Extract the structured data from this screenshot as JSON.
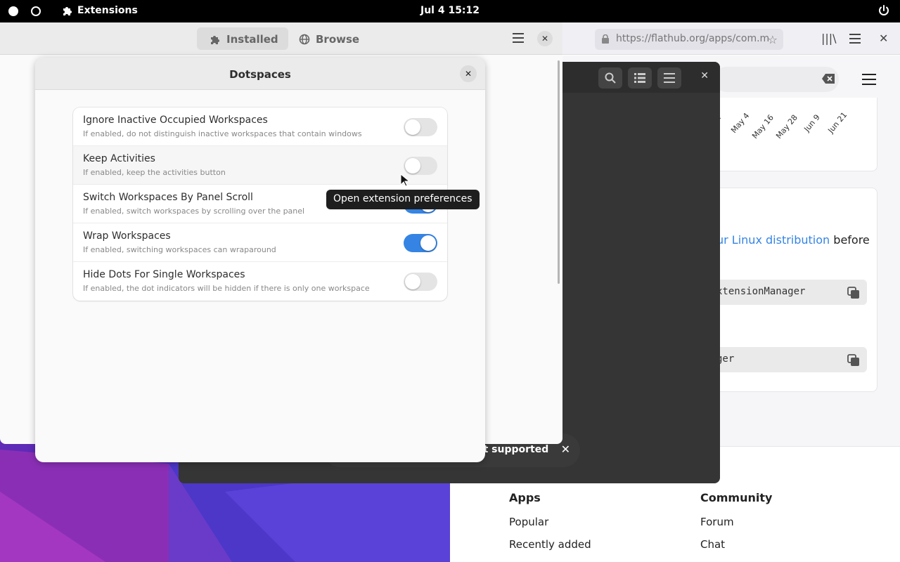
{
  "topbar": {
    "app_name": "Extensions",
    "clock": "Jul 4  15:12"
  },
  "browser": {
    "url": "https://flathub.org/apps/com.m",
    "chart_ticks": [
      "22",
      "May 4",
      "May 16",
      "May 28",
      "Jun 9",
      "Jun 21"
    ],
    "install_text_link": "ur Linux distribution",
    "install_text_rest": "before",
    "code_line_1": "xtensionManager",
    "code_line_2": "ger",
    "footer": {
      "apps_heading": "Apps",
      "apps_links": [
        "Popular",
        "Recently added"
      ],
      "community_heading": "Community",
      "community_links": [
        "Forum",
        "Chat"
      ]
    }
  },
  "dark_window": {
    "toast_text": "ot supported"
  },
  "extensions_window": {
    "tabs": [
      {
        "label": "Installed",
        "active": true
      },
      {
        "label": "Browse",
        "active": false
      }
    ]
  },
  "dialog": {
    "title": "Dotspaces",
    "rows": [
      {
        "title": "Ignore Inactive Occupied Workspaces",
        "subtitle": "If enabled, do not distinguish inactive workspaces that contain windows",
        "enabled": false
      },
      {
        "title": "Keep Activities",
        "subtitle": "If enabled, keep the activities button",
        "enabled": false
      },
      {
        "title": "Switch Workspaces By Panel Scroll",
        "subtitle": "If enabled, switch workspaces by scrolling over the panel",
        "enabled": true
      },
      {
        "title": "Wrap Workspaces",
        "subtitle": "If enabled, switching workspaces can wraparound",
        "enabled": true
      },
      {
        "title": "Hide Dots For Single Workspaces",
        "subtitle": "If enabled, the dot indicators will be hidden if there is only one workspace",
        "enabled": false
      }
    ]
  },
  "tooltip": {
    "text": "Open extension preferences"
  },
  "colors": {
    "accent": "#3584e4",
    "link": "#3584e4"
  }
}
